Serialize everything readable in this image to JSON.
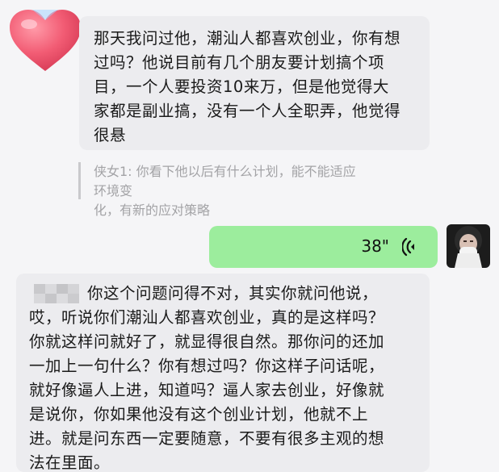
{
  "messages": {
    "first": {
      "text": "那天我问过他，潮汕人都喜欢创业，你有想\n过吗？他说目前有几个朋友要计划搞个项\n目，一个人要投资10来万，但是他觉得大\n家都是副业搞，没有一个人全职弄，他觉得\n很悬"
    },
    "quote": {
      "text": "侠女1: 你看下他以后有什么计划，能不能适应环境变\n化，有新的应对策略"
    },
    "voice": {
      "duration": "38\""
    },
    "reply": {
      "text": "你这个问题问得不对，其实你就问他说，\n哎，听说你们潮汕人都喜欢创业，真的是这样吗？\n你就这样问就好了，就显得很自然。那你问的还加\n一加上一句什么？你有想过吗？你这样子问话呢，\n就好像逼人上进，知道吗？逼人家去创业，好像就\n是说你，你如果他没有这个创业计划，他就不上\n进。就是问东西一定要随意，不要有很多主观的想\n法在里面。"
    }
  },
  "colors": {
    "incoming_bubble": "#ececef",
    "outgoing_bubble": "#9ced9d",
    "quote_text": "#a3a3a6",
    "background": "#f5f5f7"
  },
  "icons": {
    "sender_avatar": "heart-icon",
    "voice": "voice-wave-icon",
    "self_avatar": "user-photo-avatar"
  }
}
